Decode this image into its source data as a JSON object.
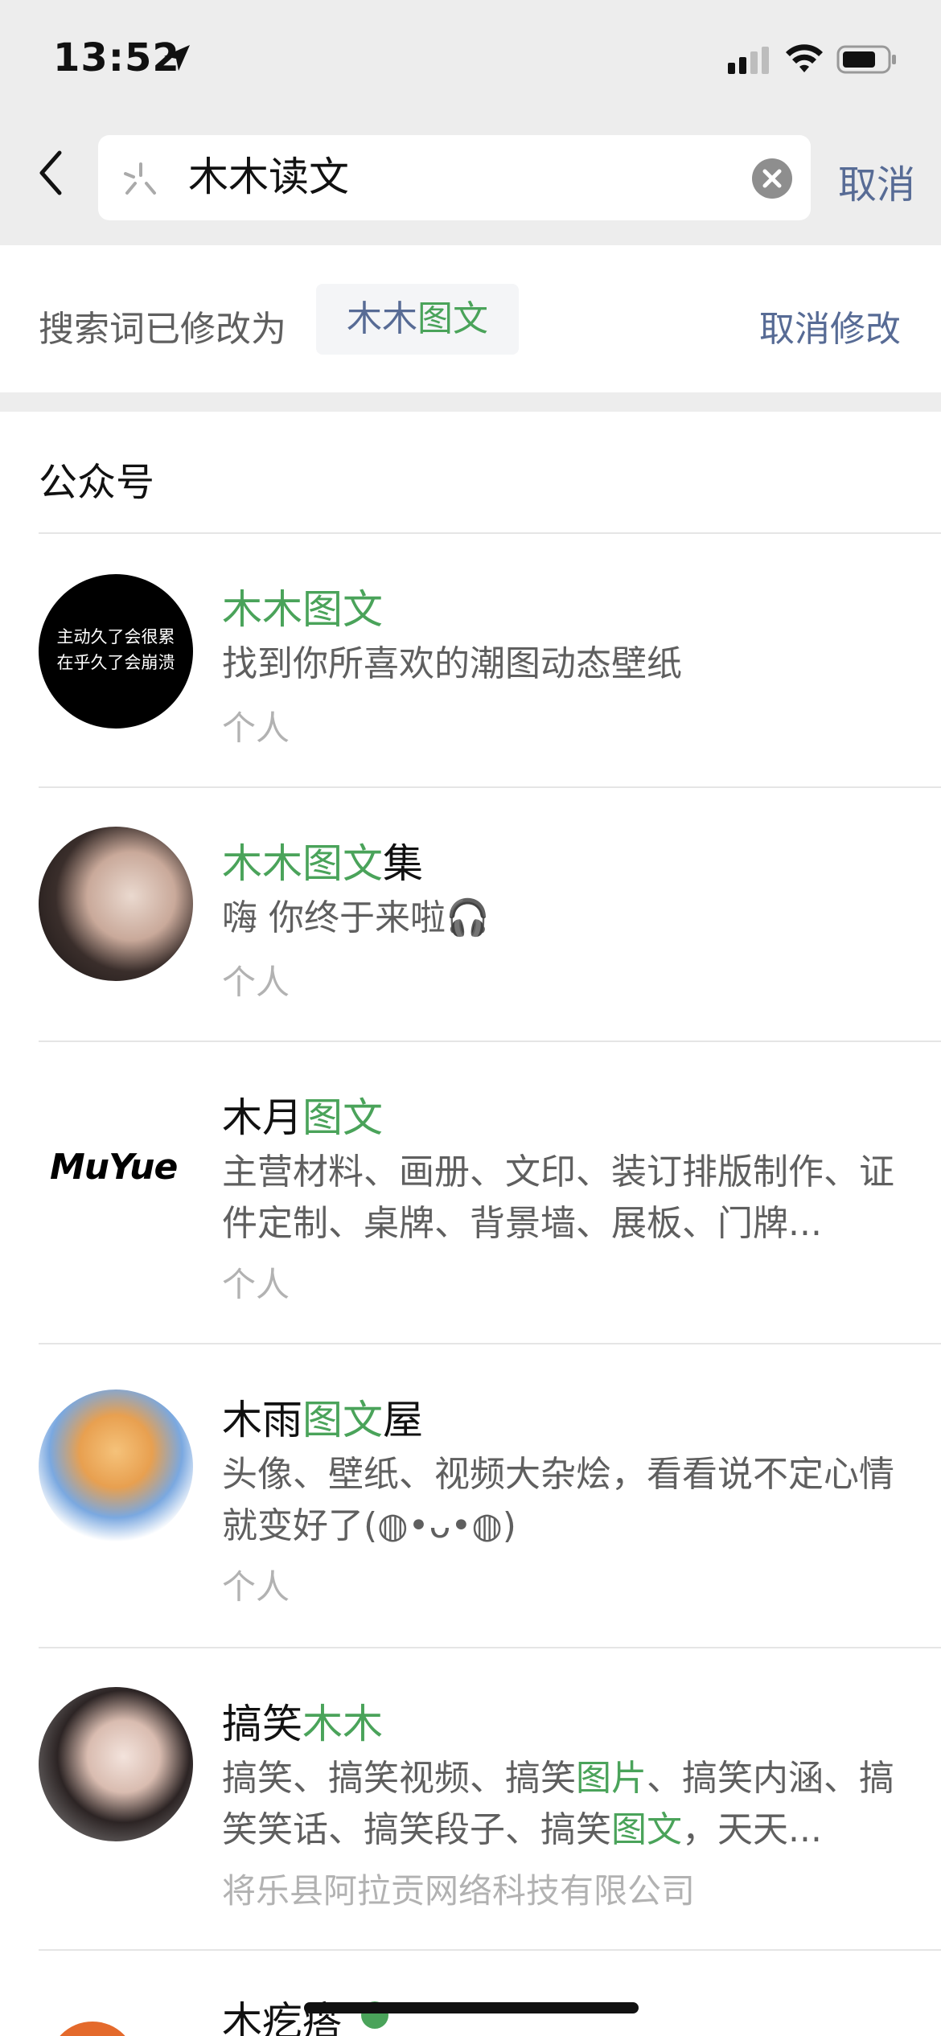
{
  "status": {
    "time": "13:52"
  },
  "search": {
    "query": "木木读文",
    "cancel_label": "取消"
  },
  "notice": {
    "prefix": "搜索词已修改为",
    "term_a": "木木",
    "term_b": "图文",
    "undo_label": "取消修改"
  },
  "section": {
    "title": "公众号"
  },
  "results": [
    {
      "title_hl": "木木图文",
      "title_rest": "",
      "desc": "找到你所喜欢的潮图动态壁纸",
      "type": "个人",
      "avatar_text_1": "主动久了会很累",
      "avatar_text_2": "在乎久了会崩溃"
    },
    {
      "title_hl": "木木图文",
      "title_rest": "集",
      "desc": "嗨 你终于来啦🎧",
      "type": "个人"
    },
    {
      "title_pre": "木月",
      "title_hl": "图文",
      "desc": "主营材料、画册、文印、装订排版制作、证件定制、桌牌、背景墙、展板、门牌...",
      "type": "个人",
      "logo_text": "MuYue"
    },
    {
      "title_pre": "木雨",
      "title_hl": "图文",
      "title_rest": "屋",
      "desc": "头像、壁纸、视频大杂烩，看看说不定心情就变好了(◍•ᴗ•◍)",
      "type": "个人"
    },
    {
      "title_pre": "搞笑",
      "title_hl": "木木",
      "desc_1": "搞笑、搞笑视频、搞笑",
      "desc_hl_1": "图片",
      "desc_2": "、搞笑内涵、搞笑笑话、搞笑段子、搞笑",
      "desc_hl_2": "图文",
      "desc_3": "，天天...",
      "type": "将乐县阿拉贡网络科技有限公司"
    },
    {
      "title_pre": "木疙瘩"
    }
  ],
  "colors": {
    "highlight": "#4aa35a",
    "link": "#576b95",
    "header_bg": "#ededed"
  }
}
